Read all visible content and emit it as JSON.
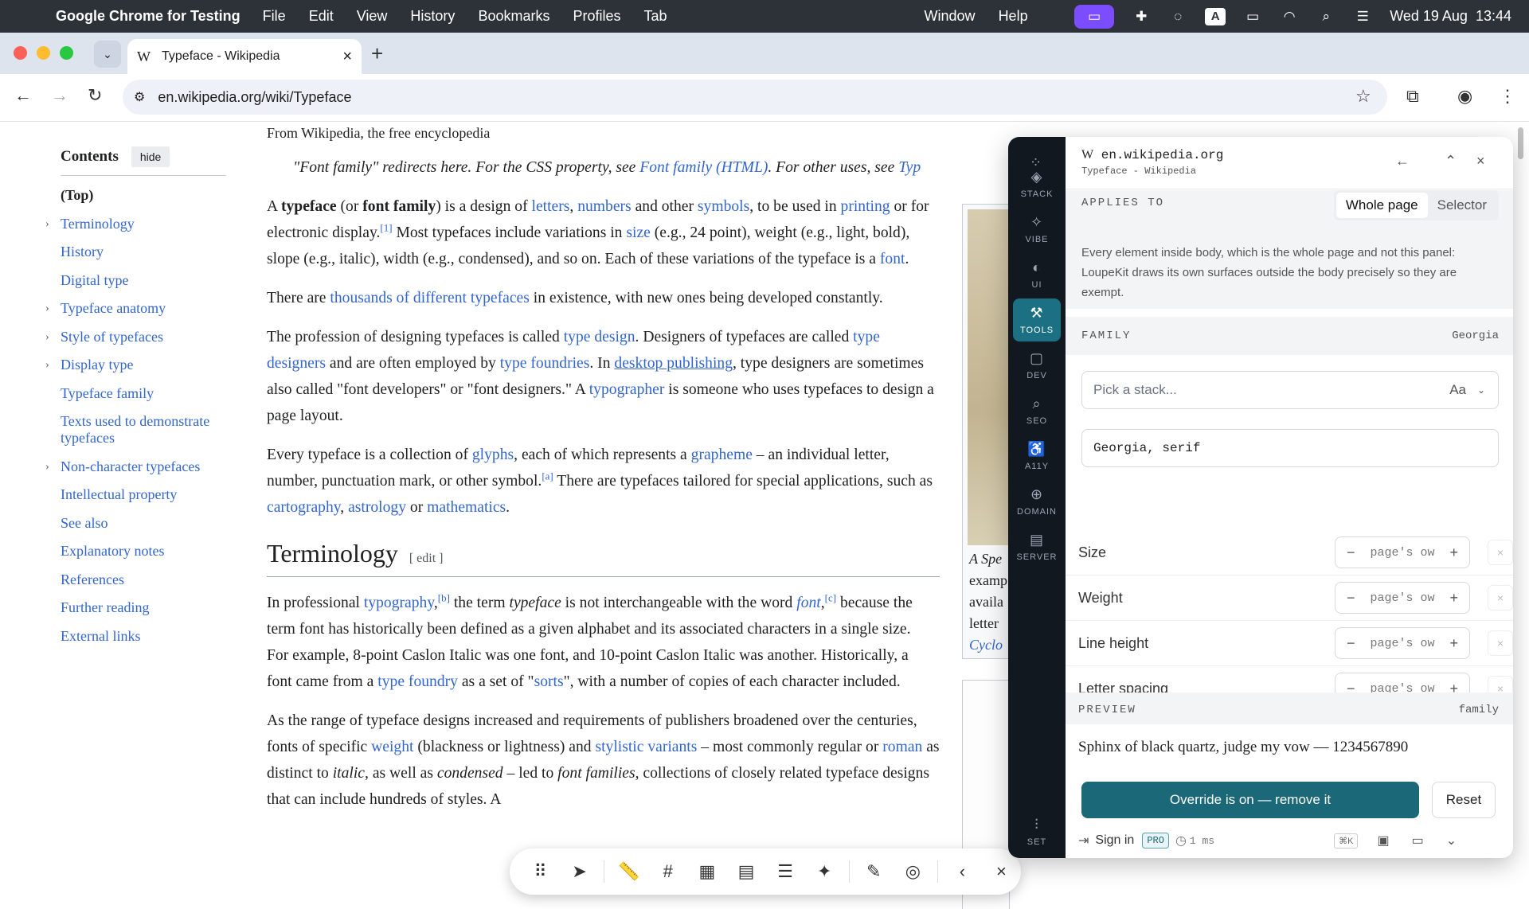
{
  "menubar": {
    "app_name": "Google Chrome for Testing",
    "items": [
      "File",
      "Edit",
      "View",
      "History",
      "Bookmarks",
      "Profiles",
      "Tab",
      "Window",
      "Help"
    ],
    "datetime": "Wed 19 Aug  13:44",
    "status_letter": "A"
  },
  "browser": {
    "tab_title": "Typeface - Wikipedia",
    "tab_favicon": "W",
    "url": "en.wikipedia.org/wiki/Typeface"
  },
  "toc": {
    "title": "Contents",
    "hide": "hide",
    "items": [
      {
        "label": "(Top)",
        "chev": false
      },
      {
        "label": "Terminology",
        "chev": true
      },
      {
        "label": "History",
        "chev": false
      },
      {
        "label": "Digital type",
        "chev": false
      },
      {
        "label": "Typeface anatomy",
        "chev": true
      },
      {
        "label": "Style of typefaces",
        "chev": true
      },
      {
        "label": "Display type",
        "chev": true
      },
      {
        "label": "Typeface family",
        "chev": false
      },
      {
        "label": "Texts used to demonstrate typefaces",
        "chev": false
      },
      {
        "label": "Non-character typefaces",
        "chev": true
      },
      {
        "label": "Intellectual property",
        "chev": false
      },
      {
        "label": "See also",
        "chev": false
      },
      {
        "label": "Explanatory notes",
        "chev": false
      },
      {
        "label": "References",
        "chev": false
      },
      {
        "label": "Further reading",
        "chev": false
      },
      {
        "label": "External links",
        "chev": false
      }
    ]
  },
  "article": {
    "from": "From Wikipedia, the free encyclopedia",
    "hatnote_pre": "\"Font family\" redirects here. For the CSS property, see ",
    "hatnote_link": "Font family (HTML)",
    "hatnote_post": ". For other uses, see ",
    "hatnote_link2": "Typ",
    "heading": "Terminology",
    "edit": "[ edit ]",
    "infobox_caption": [
      "A Spe",
      "examp",
      "availa",
      "letter",
      "Cyclo"
    ]
  },
  "panel": {
    "domain": "en.wikipedia.org",
    "subtitle": "Typeface - Wikipedia",
    "rail": [
      {
        "icon": "stack-icon",
        "label": "STACK",
        "active": false
      },
      {
        "icon": "vibe-icon",
        "label": "VIBE",
        "active": false
      },
      {
        "icon": "palette-icon",
        "label": "UI",
        "active": false
      },
      {
        "icon": "wrench-icon",
        "label": "TOOLS",
        "active": true
      },
      {
        "icon": "code-icon",
        "label": "DEV",
        "active": false
      },
      {
        "icon": "search-icon",
        "label": "SEO",
        "active": false
      },
      {
        "icon": "accessibility-icon",
        "label": "A11Y",
        "active": false
      },
      {
        "icon": "globe-icon",
        "label": "DOMAIN",
        "active": false
      },
      {
        "icon": "server-icon",
        "label": "SERVER",
        "active": false
      }
    ],
    "set_label": "SET",
    "applies_to": "APPLIES TO",
    "seg_whole": "Whole page",
    "seg_selector": "Selector",
    "description": "Every element inside body, which is the whole page and not this panel: LoupeKit draws its own surfaces outside the body precisely so they are exempt.",
    "family_label": "FAMILY",
    "family_value": "Georgia",
    "picker_placeholder": "Pick a stack...",
    "picker_aa": "Aa",
    "stack_value": "Georgia, serif",
    "props": [
      {
        "label": "Size",
        "value": "page's ow"
      },
      {
        "label": "Weight",
        "value": "page's ow"
      },
      {
        "label": "Line height",
        "value": "page's ow"
      },
      {
        "label": "Letter spacing",
        "value": "page's ow"
      }
    ],
    "preview_label": "PREVIEW",
    "preview_tag": "family",
    "preview_text": "Sphinx of black quartz, judge my vow — 1234567890",
    "override_button": "Override is on — remove it",
    "reset_button": "Reset",
    "sign_in": "Sign in",
    "pro": "PRO",
    "timing": "1 ms",
    "shortcut": "⌘K"
  },
  "colors": {
    "link": "#3366cc",
    "accent": "#1b6878",
    "rail_bg": "#111820"
  }
}
